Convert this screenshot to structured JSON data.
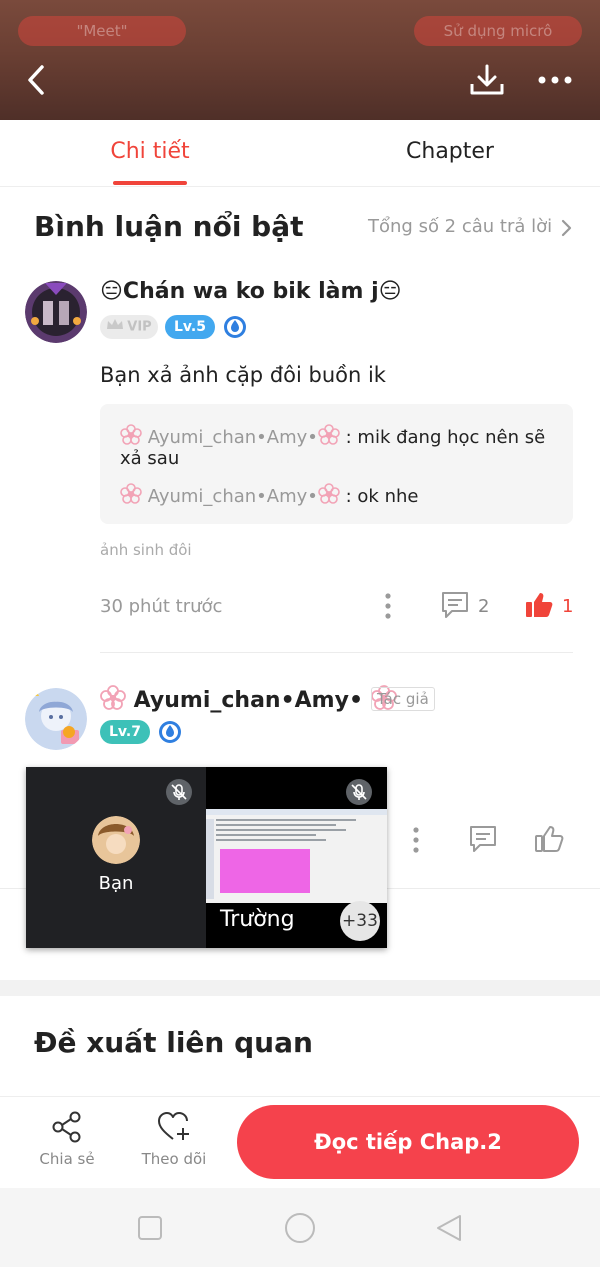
{
  "header": {
    "meet_label": "\"Meet\"",
    "micro_label": "Sử dụng micrô",
    "colors": {
      "accent": "#f0443a",
      "button": "#f5424c"
    }
  },
  "tabs": [
    {
      "label": "Chi tiết",
      "active": true
    },
    {
      "label": "Chapter",
      "active": false
    }
  ],
  "featured": {
    "title": "Bình luận nổi bật",
    "total_replies": "Tổng số 2 câu trả lời"
  },
  "comment1": {
    "username": "😑Chán wa ko bik làm j😑",
    "vip": "VIP",
    "level": "Lv.5",
    "text": "Bạn xả ảnh cặp đôi buồn ik",
    "replies": [
      {
        "user": "Ayumi_chan•Amy•",
        "sep": " : ",
        "text": "mik đang học nên sẽ",
        "text2": "xả sau"
      },
      {
        "user": "Ayumi_chan•Amy•",
        "sep": " : ",
        "text": "ok nhe"
      }
    ],
    "tag": "ảnh sinh đôi",
    "time": "30 phút trước",
    "reply_count": "2",
    "like_count": "1"
  },
  "comment2": {
    "username": "Ayumi_chan•Amy•",
    "author_tag": "Tác giả",
    "level": "Lv.7"
  },
  "video": {
    "self_label": "Bạn",
    "other_label": "Trường",
    "more_count": "+33"
  },
  "related": {
    "title": "Đề xuất liên quan"
  },
  "bottom": {
    "share_label": "Chia sẻ",
    "follow_label": "Theo dõi",
    "read_button": "Đọc tiếp Chap.2"
  }
}
